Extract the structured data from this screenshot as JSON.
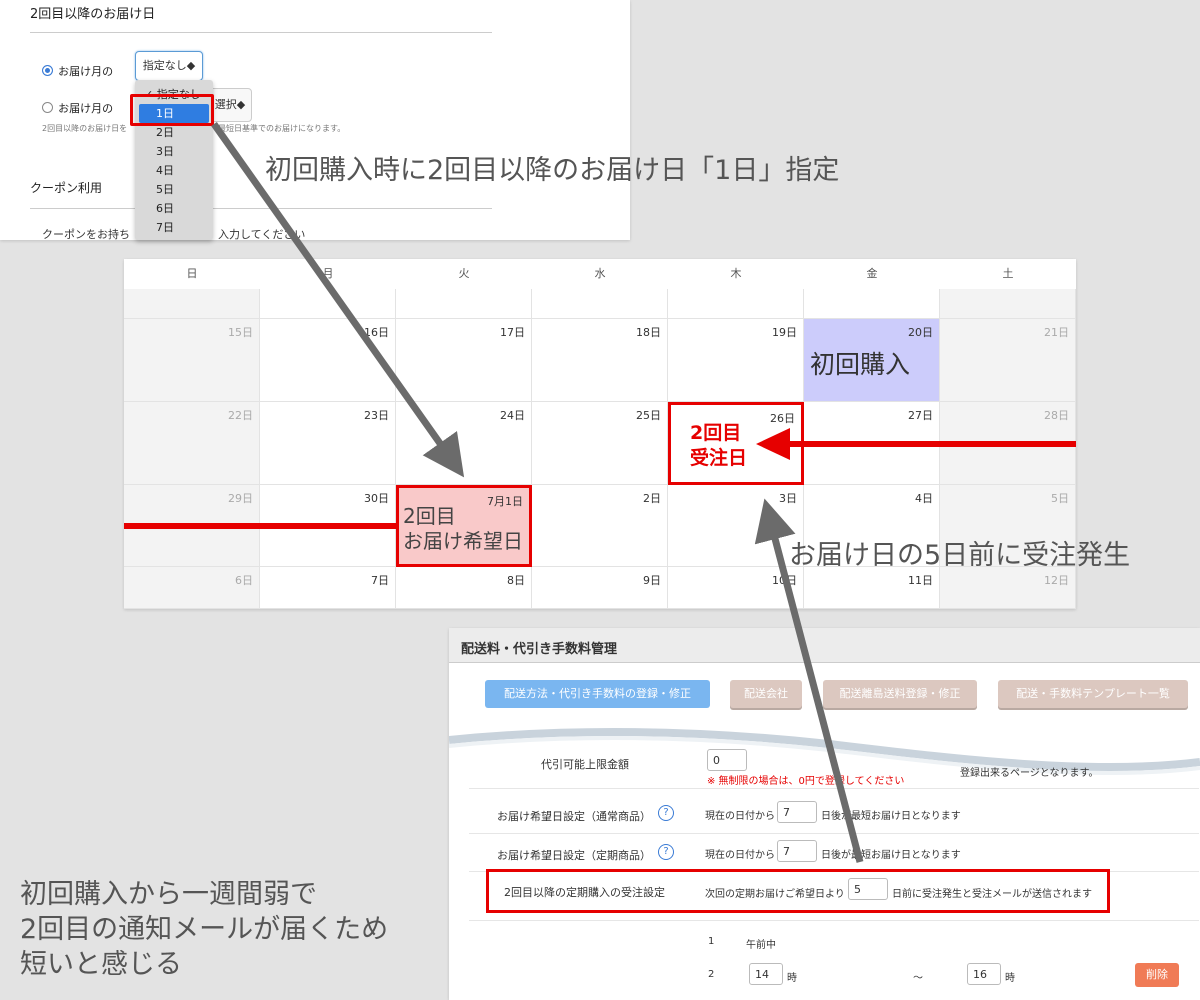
{
  "delivery_form": {
    "section_title": "2回目以降のお届け日",
    "radio_day_label": "お届け月の",
    "radio_week_label": "お届け月の",
    "select_day_value": "指定なし◆",
    "select_week_value": "選択◆",
    "note_a": "2回目以降のお届け日を",
    "note_b": "最短日基準でのお届けになります。",
    "coupon_title": "クーポン利用",
    "coupon_text_a": "クーポンをお持ち",
    "coupon_text_b": "入力してください",
    "dropdown_options": [
      "✓ 指定なし",
      "1日",
      "2日",
      "3日",
      "4日",
      "5日",
      "6日",
      "7日"
    ],
    "dropdown_selected": "1日"
  },
  "annotations": {
    "top": "初回購入時に2回目以降のお届け日「1日」指定",
    "middle": "お届け日の5日前に受注発生",
    "bottom": [
      "初回購入から一週間弱で",
      "2回目の通知メールが届くため",
      "短いと感じる"
    ]
  },
  "calendar": {
    "weekdays": [
      "日",
      "月",
      "火",
      "水",
      "木",
      "金",
      "土"
    ],
    "weeks": [
      [
        "",
        "",
        "",
        "",
        "",
        "",
        ""
      ],
      [
        "15日",
        "16日",
        "17日",
        "18日",
        "19日",
        "20日",
        "21日"
      ],
      [
        "22日",
        "23日",
        "24日",
        "25日",
        "26日",
        "27日",
        "28日"
      ],
      [
        "29日",
        "30日",
        "7月1日",
        "2日",
        "3日",
        "4日",
        "5日"
      ],
      [
        "6日",
        "7日",
        "8日",
        "9日",
        "10日",
        "11日",
        "12日"
      ]
    ],
    "first_purchase_label": "初回購入",
    "second_delivery_label": [
      "2回目",
      "お届け希望日"
    ],
    "order_day_label": [
      "2回目",
      "受注日"
    ]
  },
  "shipping_admin": {
    "title": "配送料・代引き手数料管理",
    "tabs": [
      "配送方法・代引き手数料の登録・修正",
      "配送会社",
      "配送離島送料登録・修正",
      "配送・手数料テンプレート一覧"
    ],
    "cod_limit_label": "代引可能上限金額",
    "cod_limit_value": "0",
    "cod_limit_note": "※ 無制限の場合は、0円で登録してください",
    "cod_limit_note_tail": "登録出来るページとなります。",
    "rows": [
      {
        "label": "お届け希望日設定（通常商品）",
        "prefix": "現在の日付から",
        "value": "7",
        "suffix": "日後が最短お届け日となります"
      },
      {
        "label": "お届け希望日設定（定期商品）",
        "prefix": "現在の日付から",
        "value": "7",
        "suffix": "日後が最短お届け日となります"
      },
      {
        "label": "2回目以降の定期購入の受注設定",
        "prefix": "次回の定期お届けご希望日より",
        "value": "5",
        "suffix": "日前に受注発生と受注メールが送信されます"
      }
    ],
    "time_slots": [
      {
        "no": "1",
        "text": "午前中"
      },
      {
        "no": "2",
        "from": "14",
        "to": "16",
        "unit": "時",
        "sep": "～"
      }
    ],
    "delete_label": "削除",
    "help_icon": "?"
  },
  "colors": {
    "highlight_red": "#e60000",
    "first_purchase_bg": "#ccccfb",
    "delivery_bg": "#f9c9c9",
    "arrow_gray": "#6b6b6b"
  }
}
